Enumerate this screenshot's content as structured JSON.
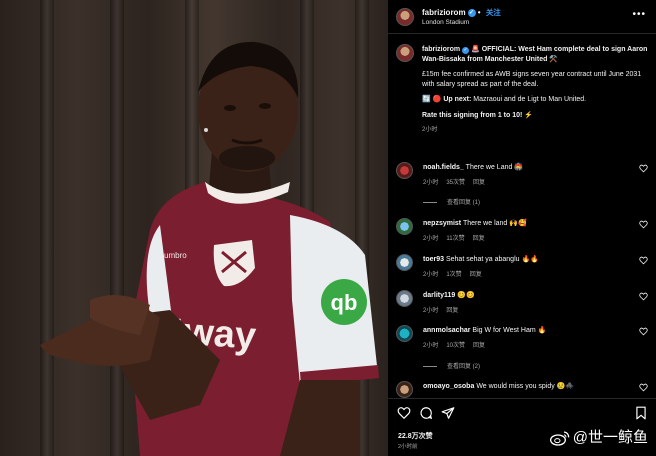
{
  "header": {
    "username": "fabriziorom",
    "follow_label": "关注",
    "location": "London Stadium",
    "more_label": "•••"
  },
  "photo": {
    "sponsor_text": "etway",
    "sleeve_logo": "qb",
    "kit_brand": "umbro",
    "colors": {
      "shirt": "#7b1e2f",
      "sleeve": "#e9edf0",
      "curtain": "#3a2f29"
    }
  },
  "caption": {
    "username": "fabriziorom",
    "line1": "🚨 OFFICIAL: West Ham complete deal to sign Aaron Wan-Bissaka from Manchester United ⚒️",
    "line2": "£15m fee confirmed as AWB signs seven year contract until June 2031 with salary spread as part of the deal.",
    "line3_bold": "Up next:",
    "line3_rest": " Mazraoui and de Ligt to Man United.",
    "line4": "Rate this signing from 1 to 10! ⚡",
    "time": "2小时"
  },
  "comments": [
    {
      "user": "noah.fields_",
      "text": "There we Land 🏟️",
      "time": "2小时",
      "likes": "35次赞",
      "reply": "回复",
      "view_replies": "查看回复 (1)"
    },
    {
      "user": "nepzsymist",
      "text": "There we land 🙌🥰",
      "time": "2小时",
      "likes": "11次赞",
      "reply": "回复"
    },
    {
      "user": "toer93",
      "text": "Sehat sehat ya abanglu 🔥🔥",
      "time": "2小时",
      "likes": "1次赞",
      "reply": "回复"
    },
    {
      "user": "darlity119",
      "text": "😊😊",
      "time": "2小时",
      "reply": "回复"
    },
    {
      "user": "annmolsachar",
      "text": "Big W for West Ham 🔥",
      "time": "2小时",
      "likes": "10次赞",
      "reply": "回复",
      "view_replies": "查看回复 (2)"
    },
    {
      "user": "omoayo_osoba",
      "text": "We would miss you spidy 😢🕷️",
      "time": "2小时"
    }
  ],
  "footer": {
    "likes_count": "22.8万次赞",
    "time": "2小时前"
  },
  "watermark": "@世一鲸鱼",
  "colors": {
    "accent": "#3897f0",
    "muted": "#a8a8a8",
    "background": "#000000"
  },
  "icons": [
    "heart-icon",
    "comment-icon",
    "share-icon",
    "bookmark-icon",
    "more-icon",
    "verified-icon"
  ]
}
